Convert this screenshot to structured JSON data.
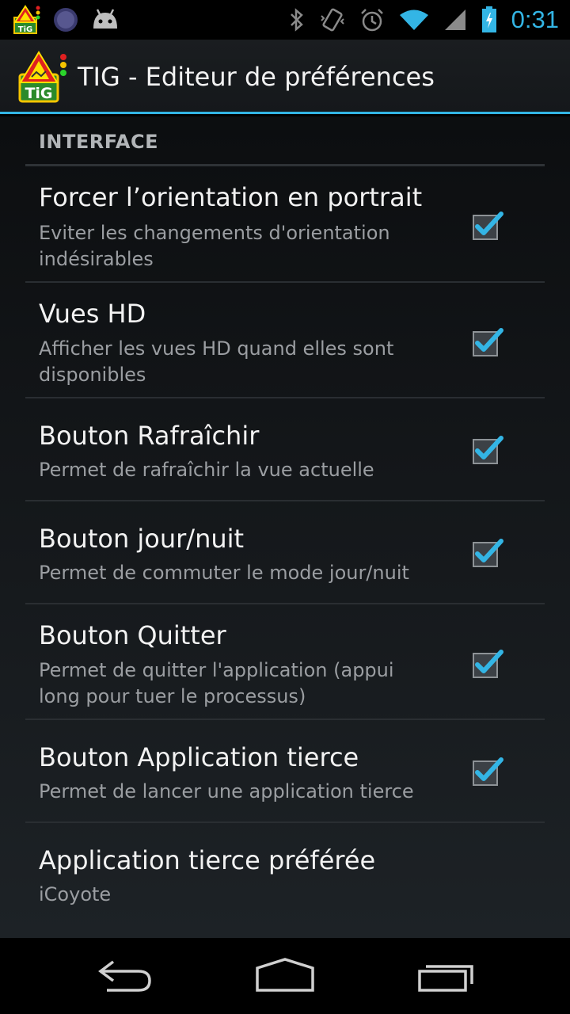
{
  "status_bar": {
    "time": "0:31",
    "notification_icons": [
      "tig-app-icon",
      "app-circle-icon",
      "android-robot-icon"
    ],
    "system_icons": [
      "bluetooth-icon",
      "vibrate-icon",
      "alarm-icon",
      "wifi-icon",
      "cell-signal-icon",
      "battery-charging-icon"
    ]
  },
  "action_bar": {
    "title": "TIG - Editeur de préférences",
    "logo_text": "TiG"
  },
  "section": {
    "header": "INTERFACE"
  },
  "preferences": [
    {
      "title": "Forcer l’orientation en portrait",
      "summary": "Eviter les changements d'orientation indésirables",
      "checked": true
    },
    {
      "title": "Vues HD",
      "summary": "Afficher les vues HD quand elles sont disponibles",
      "checked": true
    },
    {
      "title": "Bouton Rafraîchir",
      "summary": "Permet de rafraîchir la vue actuelle",
      "checked": true
    },
    {
      "title": "Bouton jour/nuit",
      "summary": "Permet de commuter le mode jour/nuit",
      "checked": true
    },
    {
      "title": "Bouton Quitter",
      "summary": "Permet de quitter l'application (appui long pour tuer le processus)",
      "checked": true
    },
    {
      "title": "Bouton Application tierce",
      "summary": "Permet de lancer une application tierce",
      "checked": true
    },
    {
      "title": "Application tierce préférée",
      "summary": "iCoyote"
    }
  ],
  "colors": {
    "accent": "#33b5e5",
    "background": "#14171a",
    "text_primary": "#f2f2f2",
    "text_secondary": "#9b9ea2"
  },
  "nav_bar": {
    "buttons": [
      "back-icon",
      "home-icon",
      "recent-apps-icon"
    ]
  }
}
